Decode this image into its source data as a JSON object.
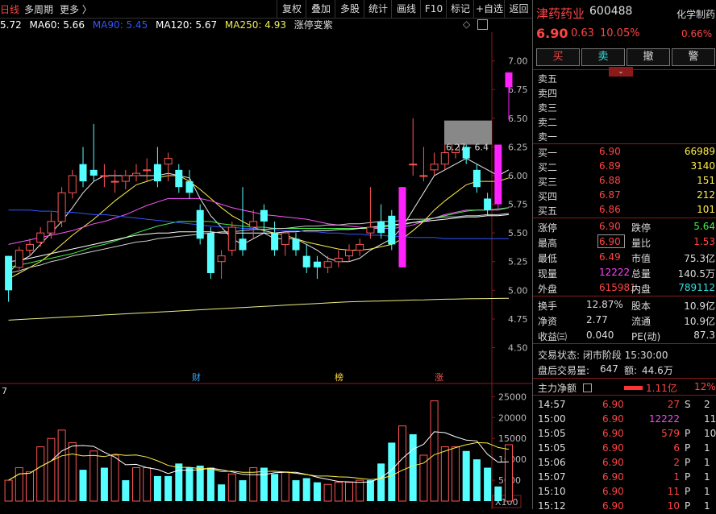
{
  "toolbar": {
    "period": "日线",
    "multi_period": "多周期",
    "more": "更多 〉",
    "buttons": [
      "复权",
      "叠加",
      "多股",
      "统计",
      "画线",
      "F10",
      "标记",
      "+自选",
      "返回"
    ]
  },
  "ma_legend": [
    {
      "text": "5.72",
      "color": "#dddddd"
    },
    {
      "text": "MA60: 5.66",
      "color": "#ffffff"
    },
    {
      "text": "MA90: 5.45",
      "color": "#3355ff"
    },
    {
      "text": "MA120: 5.67",
      "color": "#ffffff"
    },
    {
      "text": "MA250: 4.93",
      "color": "#eeee55"
    },
    {
      "text": "涨停变紫",
      "color": "#dddddd"
    }
  ],
  "chart_data": {
    "type": "candlestick",
    "y_ticks": [
      "7.00",
      "6.75",
      "6.50",
      "6.25",
      "6.00",
      "5.75",
      "5.50",
      "5.25",
      "5.00",
      "4.75",
      "4.50"
    ],
    "ylim": [
      4.3,
      7.25
    ],
    "range_label": "6.27 - 6.4",
    "markers": [
      {
        "text": "财",
        "color": "#33aaff"
      },
      {
        "text": "榜",
        "color": "#ffdd44"
      },
      {
        "text": "涨",
        "color": "#ff5555"
      }
    ],
    "candles": [
      [
        5.3,
        5.0,
        5.3,
        4.9
      ],
      [
        5.2,
        5.35,
        5.38,
        5.18
      ],
      [
        5.35,
        5.4,
        5.45,
        5.3
      ],
      [
        5.42,
        5.5,
        5.55,
        5.38
      ],
      [
        5.5,
        5.6,
        5.68,
        5.45
      ],
      [
        5.6,
        5.85,
        5.9,
        5.55
      ],
      [
        5.85,
        6.0,
        6.05,
        5.8
      ],
      [
        6.1,
        5.95,
        6.25,
        5.9
      ],
      [
        6.05,
        6.0,
        6.45,
        5.95
      ],
      [
        6.0,
        6.0,
        6.1,
        5.9
      ],
      [
        5.95,
        5.95,
        6.05,
        5.85
      ],
      [
        5.95,
        6.0,
        6.05,
        5.88
      ],
      [
        6.0,
        6.02,
        6.1,
        5.95
      ],
      [
        6.05,
        6.05,
        6.15,
        5.95
      ],
      [
        6.1,
        5.95,
        6.25,
        5.9
      ],
      [
        6.1,
        6.15,
        6.2,
        5.95
      ],
      [
        6.05,
        5.9,
        6.1,
        5.85
      ],
      [
        5.95,
        5.85,
        6.05,
        5.8
      ],
      [
        5.7,
        5.45,
        5.75,
        5.4
      ],
      [
        5.5,
        5.15,
        5.55,
        5.1
      ],
      [
        5.25,
        5.3,
        5.35,
        5.1
      ],
      [
        5.35,
        5.55,
        5.6,
        5.3
      ],
      [
        5.45,
        5.35,
        5.9,
        5.3
      ],
      [
        5.55,
        5.6,
        5.7,
        5.45
      ],
      [
        5.7,
        5.6,
        5.75,
        5.5
      ],
      [
        5.5,
        5.35,
        5.6,
        5.3
      ],
      [
        5.4,
        5.5,
        5.5,
        5.3
      ],
      [
        5.45,
        5.35,
        5.5,
        5.3
      ],
      [
        5.3,
        5.2,
        5.4,
        5.15
      ],
      [
        5.25,
        5.2,
        5.3,
        5.1
      ],
      [
        5.2,
        5.25,
        5.3,
        5.15
      ],
      [
        5.25,
        5.28,
        5.35,
        5.2
      ],
      [
        5.3,
        5.35,
        5.4,
        5.25
      ],
      [
        5.35,
        5.4,
        5.45,
        5.3
      ],
      [
        5.5,
        5.55,
        5.9,
        5.45
      ],
      [
        5.6,
        5.5,
        5.75,
        5.45
      ],
      [
        5.65,
        5.4,
        5.7,
        5.35
      ],
      [
        5.2,
        5.9,
        5.9,
        5.2
      ],
      [
        6.1,
        6.1,
        6.5,
        6.0
      ],
      [
        6.0,
        6.0,
        6.25,
        5.95
      ],
      [
        6.05,
        6.1,
        6.2,
        6.0
      ],
      [
        6.1,
        6.2,
        6.3,
        6.05
      ],
      [
        6.2,
        6.3,
        6.35,
        6.15
      ],
      [
        6.25,
        6.15,
        6.3,
        6.1
      ],
      [
        6.05,
        5.9,
        6.1,
        5.85
      ],
      [
        5.8,
        5.7,
        5.85,
        5.65
      ],
      [
        5.75,
        6.27,
        6.27,
        5.7
      ],
      [
        6.77,
        6.9,
        6.9,
        6.49
      ]
    ],
    "ma_series": [
      {
        "name": "MA5",
        "color": "#e8e8e8",
        "values": [
          5.15,
          5.25,
          5.3,
          5.4,
          5.5,
          5.6,
          5.72,
          5.85,
          5.95,
          6.0,
          6.0,
          6.0,
          6.0,
          6.0,
          6.0,
          6.02,
          6.0,
          5.98,
          5.8,
          5.65,
          5.55,
          5.45,
          5.4,
          5.45,
          5.5,
          5.45,
          5.45,
          5.45,
          5.4,
          5.35,
          5.28,
          5.25,
          5.25,
          5.28,
          5.35,
          5.4,
          5.45,
          5.55,
          5.7,
          5.85,
          6.0,
          6.05,
          6.1,
          6.15,
          6.1,
          6.05,
          6.0,
          6.05
        ]
      },
      {
        "name": "MA10",
        "color": "#ffee44",
        "values": [
          5.1,
          5.15,
          5.2,
          5.25,
          5.32,
          5.4,
          5.48,
          5.55,
          5.62,
          5.7,
          5.78,
          5.85,
          5.92,
          5.95,
          5.98,
          6.0,
          6.0,
          5.95,
          5.88,
          5.8,
          5.72,
          5.65,
          5.6,
          5.55,
          5.52,
          5.5,
          5.48,
          5.45,
          5.42,
          5.4,
          5.38,
          5.36,
          5.35,
          5.35,
          5.36,
          5.38,
          5.4,
          5.45,
          5.52,
          5.6,
          5.7,
          5.78,
          5.85,
          5.92,
          5.95,
          5.95,
          5.95,
          5.98
        ]
      },
      {
        "name": "MA20",
        "color": "#ff55ff",
        "values": [
          5.4,
          5.42,
          5.44,
          5.46,
          5.48,
          5.5,
          5.52,
          5.55,
          5.58,
          5.6,
          5.63,
          5.66,
          5.7,
          5.74,
          5.77,
          5.8,
          5.8,
          5.8,
          5.8,
          5.78,
          5.75,
          5.72,
          5.7,
          5.68,
          5.66,
          5.65,
          5.64,
          5.63,
          5.62,
          5.6,
          5.58,
          5.57,
          5.56,
          5.55,
          5.54,
          5.54,
          5.54,
          5.55,
          5.57,
          5.6,
          5.63,
          5.66,
          5.68,
          5.7,
          5.7,
          5.7,
          5.7,
          5.72
        ]
      },
      {
        "name": "MA30",
        "color": "#44ee44",
        "values": [
          5.2,
          5.22,
          5.24,
          5.26,
          5.28,
          5.3,
          5.32,
          5.35,
          5.38,
          5.4,
          5.43,
          5.46,
          5.5,
          5.53,
          5.56,
          5.58,
          5.6,
          5.6,
          5.6,
          5.6,
          5.58,
          5.57,
          5.56,
          5.55,
          5.55,
          5.54,
          5.54,
          5.54,
          5.54,
          5.54,
          5.54,
          5.54,
          5.54,
          5.54,
          5.54,
          5.55,
          5.56,
          5.57,
          5.59,
          5.61,
          5.63,
          5.65,
          5.67,
          5.69,
          5.7,
          5.7,
          5.71,
          5.72
        ]
      },
      {
        "name": "MA60",
        "color": "#ffffff",
        "values": [
          5.25,
          5.26,
          5.28,
          5.3,
          5.32,
          5.34,
          5.36,
          5.38,
          5.4,
          5.42,
          5.44,
          5.46,
          5.48,
          5.49,
          5.5,
          5.5,
          5.51,
          5.51,
          5.51,
          5.51,
          5.5,
          5.5,
          5.5,
          5.5,
          5.5,
          5.5,
          5.51,
          5.51,
          5.52,
          5.52,
          5.52,
          5.53,
          5.53,
          5.54,
          5.55,
          5.56,
          5.57,
          5.58,
          5.59,
          5.6,
          5.61,
          5.62,
          5.63,
          5.64,
          5.64,
          5.65,
          5.65,
          5.66
        ]
      },
      {
        "name": "MA90",
        "color": "#3355ff",
        "values": [
          5.7,
          5.7,
          5.7,
          5.69,
          5.69,
          5.68,
          5.68,
          5.67,
          5.66,
          5.66,
          5.65,
          5.64,
          5.63,
          5.62,
          5.61,
          5.6,
          5.59,
          5.58,
          5.57,
          5.56,
          5.55,
          5.55,
          5.54,
          5.54,
          5.53,
          5.53,
          5.52,
          5.52,
          5.51,
          5.51,
          5.5,
          5.5,
          5.49,
          5.49,
          5.48,
          5.48,
          5.47,
          5.47,
          5.46,
          5.46,
          5.46,
          5.45,
          5.45,
          5.45,
          5.45,
          5.45,
          5.45,
          5.45
        ]
      },
      {
        "name": "MA120",
        "color": "#cccccc",
        "values": [
          5.15,
          5.17,
          5.2,
          5.22,
          5.25,
          5.27,
          5.3,
          5.32,
          5.34,
          5.36,
          5.38,
          5.4,
          5.42,
          5.43,
          5.45,
          5.46,
          5.47,
          5.48,
          5.49,
          5.5,
          5.51,
          5.51,
          5.52,
          5.53,
          5.53,
          5.54,
          5.54,
          5.55,
          5.56,
          5.56,
          5.57,
          5.57,
          5.58,
          5.58,
          5.59,
          5.6,
          5.6,
          5.61,
          5.62,
          5.62,
          5.63,
          5.64,
          5.64,
          5.65,
          5.65,
          5.66,
          5.66,
          5.67
        ]
      },
      {
        "name": "MA250",
        "color": "#eeee88",
        "values": [
          4.74,
          4.745,
          4.75,
          4.755,
          4.76,
          4.765,
          4.77,
          4.775,
          4.78,
          4.785,
          4.79,
          4.795,
          4.8,
          4.805,
          4.81,
          4.815,
          4.82,
          4.825,
          4.83,
          4.835,
          4.84,
          4.845,
          4.85,
          4.855,
          4.86,
          4.865,
          4.87,
          4.875,
          4.88,
          4.885,
          4.89,
          4.895,
          4.9,
          4.902,
          4.905,
          4.907,
          4.91,
          4.912,
          4.915,
          4.917,
          4.92,
          4.922,
          4.924,
          4.926,
          4.927,
          4.928,
          4.929,
          4.93
        ]
      }
    ],
    "volume_ticks": [
      "25000",
      "20000",
      "15000",
      "10000",
      "5000"
    ],
    "volume_unit": "X100",
    "volume_left_label": "7",
    "volume_ylim": [
      0,
      27000
    ],
    "volumes": [
      5000,
      8000,
      7000,
      13000,
      15000,
      17000,
      14000,
      7500,
      12000,
      8000,
      11000,
      5000,
      8000,
      8000,
      6000,
      6000,
      9000,
      8000,
      8500,
      8000,
      4000,
      6500,
      5000,
      8000,
      8000,
      6500,
      7000,
      5000,
      5500,
      4500,
      4000,
      4500,
      4500,
      5000,
      5000,
      9000,
      14000,
      18000,
      16000,
      11000,
      24000,
      13000,
      13000,
      12000,
      10000,
      8000,
      3500,
      13500
    ],
    "volume_colors": [
      "r",
      "r",
      "r",
      "r",
      "r",
      "r",
      "r",
      "c",
      "r",
      "c",
      "r",
      "c",
      "r",
      "r",
      "c",
      "c",
      "c",
      "c",
      "c",
      "c",
      "c",
      "r",
      "c",
      "r",
      "c",
      "c",
      "r",
      "c",
      "c",
      "c",
      "r",
      "r",
      "r",
      "r",
      "c",
      "c",
      "c",
      "r",
      "c",
      "r",
      "r",
      "r",
      "r",
      "c",
      "c",
      "c",
      "c",
      "r"
    ]
  },
  "stock": {
    "name": "津药药业",
    "code": "600488",
    "tag": "化学制药",
    "price": "6.90",
    "change": "0.63",
    "change_pct": "10.05%",
    "tag_pct": "0.66%"
  },
  "trade_buttons": [
    "买",
    "卖",
    "撤",
    "警"
  ],
  "orderbook": {
    "sell": [
      {
        "label": "卖五"
      },
      {
        "label": "卖四"
      },
      {
        "label": "卖三"
      },
      {
        "label": "卖二"
      },
      {
        "label": "卖一"
      }
    ],
    "buy": [
      {
        "label": "买一",
        "price": "6.90",
        "vol": "66989"
      },
      {
        "label": "买二",
        "price": "6.89",
        "vol": "3140"
      },
      {
        "label": "买三",
        "price": "6.88",
        "vol": "151"
      },
      {
        "label": "买四",
        "price": "6.87",
        "vol": "212"
      },
      {
        "label": "买五",
        "price": "6.86",
        "vol": "101"
      }
    ]
  },
  "stats1": [
    {
      "l1": "涨停",
      "v1": "6.90",
      "l2": "跌停",
      "v2": "5.64"
    },
    {
      "l1": "最高",
      "v1": "6.90",
      "l2": "量比",
      "v2": "1.53"
    },
    {
      "l1": "最低",
      "v1": "6.49",
      "l2": "市值",
      "v2": "75.3亿"
    },
    {
      "l1": "现量",
      "v1": "12222",
      "l2": "总量",
      "v2": "140.5万"
    },
    {
      "l1": "外盘",
      "v1": "615981",
      "l2": "内盘",
      "v2": "789112"
    }
  ],
  "stats2": [
    {
      "l1": "换手",
      "v1": "12.87%",
      "l2": "股本",
      "v2": "10.9亿"
    },
    {
      "l1": "净资",
      "v1": "2.77",
      "l2": "流通",
      "v2": "10.9亿"
    },
    {
      "l1": "收益㈢",
      "v1": "0.040",
      "l2": "PE(动)",
      "v2": "87.3"
    }
  ],
  "status": {
    "trade_status": "交易状态: 闭市阶段 15:30:00",
    "after_hours_label": "盘后交易量:",
    "after_hours_vol": "647",
    "after_hours_amt_label": "额:",
    "after_hours_amt": "44.6万"
  },
  "main_flow": {
    "label": "主力净额",
    "value": "1.11亿",
    "pct": "12%"
  },
  "ticks": [
    {
      "time": "14:57",
      "price": "6.90",
      "vol": "27",
      "side": "S",
      "extra": "2"
    },
    {
      "time": "15:00",
      "price": "6.90",
      "vol": "12222",
      "side": "",
      "extra": "119"
    },
    {
      "time": "15:05",
      "price": "6.90",
      "vol": "579",
      "side": "P",
      "extra": "10"
    },
    {
      "time": "15:05",
      "price": "6.90",
      "vol": "6",
      "side": "P",
      "extra": "1"
    },
    {
      "time": "15:06",
      "price": "6.90",
      "vol": "2",
      "side": "P",
      "extra": "1"
    },
    {
      "time": "15:07",
      "price": "6.90",
      "vol": "1",
      "side": "P",
      "extra": "1"
    },
    {
      "time": "15:10",
      "price": "6.90",
      "vol": "11",
      "side": "P",
      "extra": "1"
    },
    {
      "time": "15:12",
      "price": "6.90",
      "vol": "10",
      "side": "P",
      "extra": "1"
    }
  ]
}
